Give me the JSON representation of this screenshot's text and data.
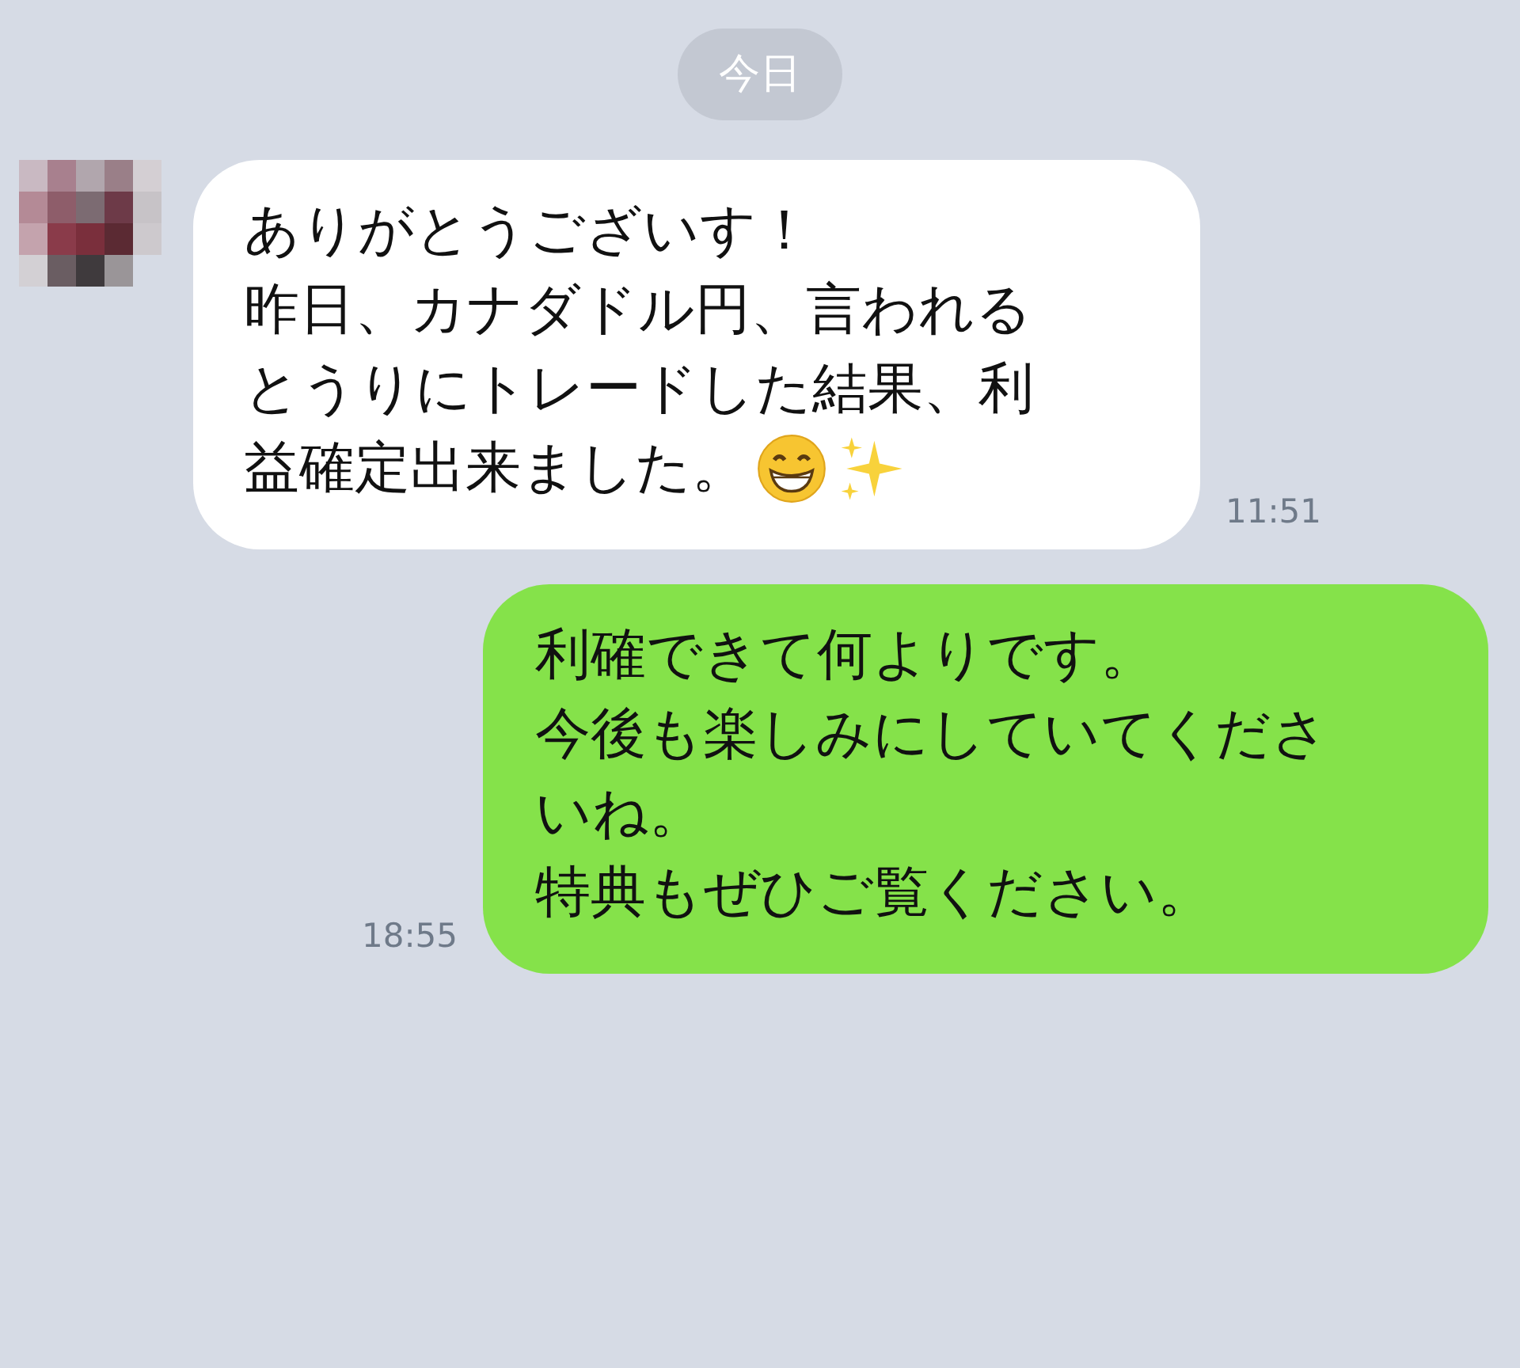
{
  "date_label": "今日",
  "messages": [
    {
      "kind": "incoming",
      "lines": [
        "ありがとうございす！",
        "昨日、カナダドル円、言われる",
        "とうりにトレードした結果、利",
        "益確定出来ました。"
      ],
      "emoji": [
        {
          "kind": "grinning"
        },
        {
          "kind": "sparkles"
        }
      ],
      "time": "11:51"
    },
    {
      "kind": "outgoing",
      "lines": [
        "利確できて何よりです。",
        "今後も楽しみにしていてくださ",
        "いね。",
        "特典もぜひご覧ください。"
      ],
      "time": "18:55"
    }
  ]
}
